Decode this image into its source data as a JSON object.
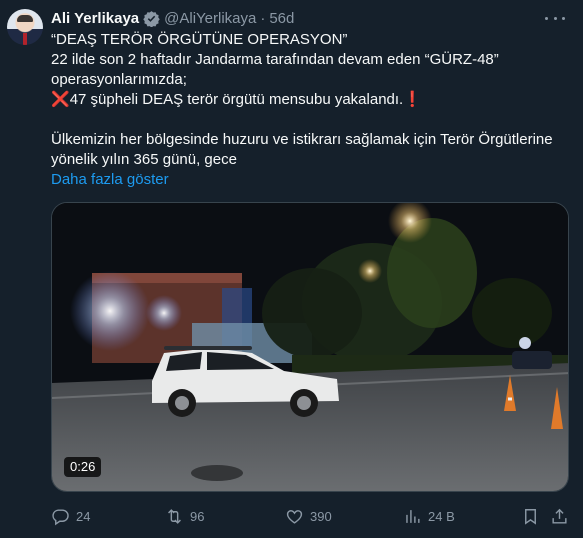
{
  "author": {
    "name": "Ali Yerlikaya",
    "handle": "@AliYerlikaya",
    "separator": "·",
    "time": "56d"
  },
  "text": {
    "line1": "“DEAŞ TERÖR ÖRGÜTÜNE OPERASYON”",
    "line2": "22 ilde son 2 haftadır Jandarma tarafından devam eden “GÜRZ-48”",
    "line3": "operasyonlarımızda;",
    "line4_icon": "❌",
    "line4": "47 şüpheli DEAŞ terör örgütü mensubu yakalandı.",
    "line4_end": "❗",
    "line5": "Ülkemizin her bölgesinde huzuru ve istikrarı sağlamak için Terör Örgütlerine",
    "line6": "yönelik yılın 365 günü, gece",
    "show_more": "Daha fazla göster"
  },
  "media": {
    "duration": "0:26"
  },
  "stats": {
    "replies": "24",
    "reposts": "96",
    "likes": "390",
    "views": "24 B"
  },
  "icons": [
    "verified-badge-icon",
    "more-icon",
    "reply-icon",
    "repost-icon",
    "like-icon",
    "views-icon",
    "bookmark-icon",
    "share-icon"
  ],
  "colors": {
    "background": "#15202b",
    "accent": "#1d9bf0",
    "secondary_text": "#8b98a5"
  }
}
